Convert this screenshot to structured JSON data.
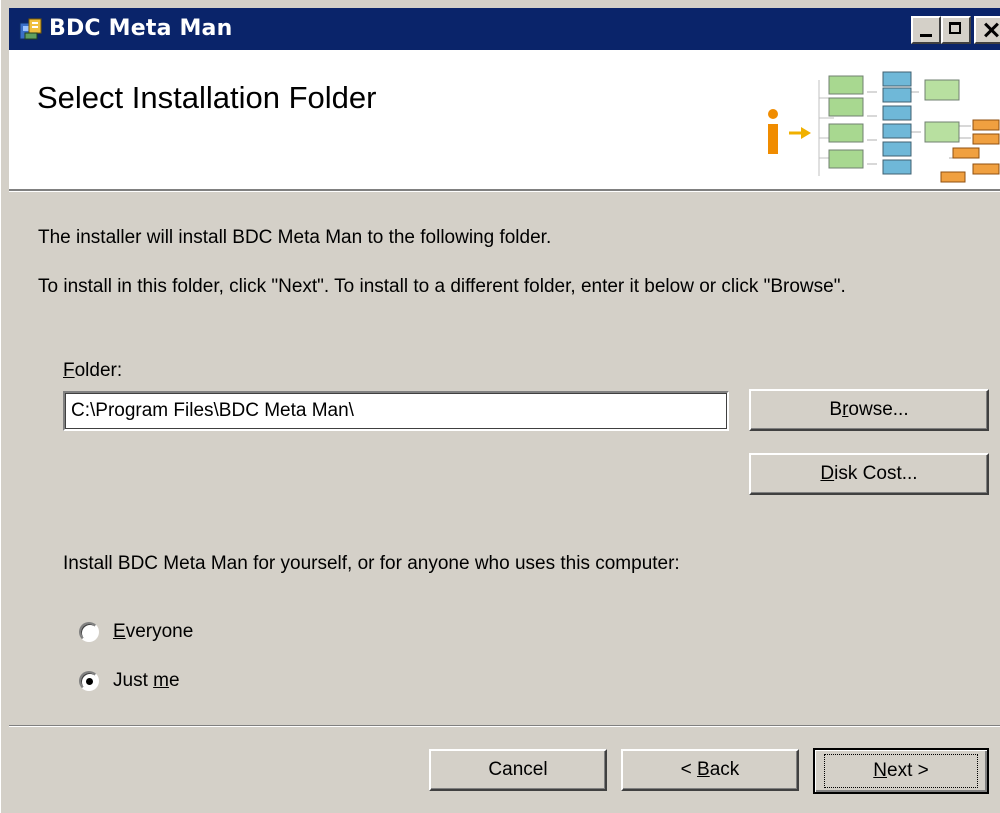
{
  "window": {
    "title": "BDC Meta Man"
  },
  "banner": {
    "title": "Select Installation Folder"
  },
  "content": {
    "line1": "The installer will install BDC Meta Man to the following folder.",
    "line2": "To install in this folder, click \"Next\". To install to a different folder, enter it below or click \"Browse\".",
    "folder_label_first": "F",
    "folder_label_rest": "older:",
    "folder_value": "C:\\Program Files\\BDC Meta Man\\",
    "browse_pre": "B",
    "browse_u": "r",
    "browse_post": "owse...",
    "diskcost_u": "D",
    "diskcost_rest": "isk Cost...",
    "install_for": "Install BDC Meta Man for yourself, or for anyone who uses this computer:",
    "radio_everyone_u": "E",
    "radio_everyone_rest": "veryone",
    "radio_justme_pre": "Just ",
    "radio_justme_u": "m",
    "radio_justme_post": "e",
    "selected_option": "Just me"
  },
  "footer": {
    "cancel": "Cancel",
    "back_pre": "< ",
    "back_u": "B",
    "back_rest": "ack",
    "next_u": "N",
    "next_rest": "ext >"
  },
  "colors": {
    "titlebar": "#0a246a",
    "face": "#d4d0c8",
    "banner": "#ffffff"
  },
  "icons": [
    "installer-app-icon",
    "minimize-icon",
    "maximize-icon",
    "close-icon",
    "setup-banner-graphic"
  ]
}
